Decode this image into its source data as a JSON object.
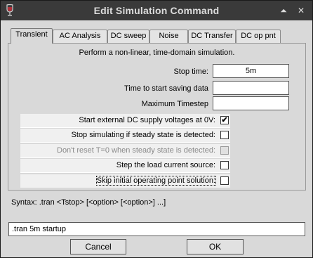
{
  "window": {
    "title": "Edit Simulation Command",
    "max_glyph": "⏶",
    "close_glyph": "✕"
  },
  "tabs": [
    {
      "label": "Transient",
      "active": true
    },
    {
      "label": "AC Analysis",
      "active": false
    },
    {
      "label": "DC sweep",
      "active": false
    },
    {
      "label": "Noise",
      "active": false
    },
    {
      "label": "DC Transfer",
      "active": false
    },
    {
      "label": "DC op pnt",
      "active": false
    }
  ],
  "transient": {
    "description": "Perform a non-linear, time-domain simulation.",
    "stop_time_label": "Stop time:",
    "stop_time_value": "5m",
    "start_saving_label": "Time to start saving data",
    "start_saving_value": "",
    "max_timestep_label": "Maximum Timestep",
    "max_timestep_value": "",
    "options": [
      {
        "label": "Start external DC supply voltages at 0V:",
        "checked": true,
        "enabled": true
      },
      {
        "label": "Stop simulating if steady state is detected:",
        "checked": false,
        "enabled": true
      },
      {
        "label": "Don't reset T=0 when steady state is detected:",
        "checked": false,
        "enabled": false
      },
      {
        "label": "Step the load current source:",
        "checked": false,
        "enabled": true
      },
      {
        "label": "Skip initial operating point solution:",
        "checked": false,
        "enabled": true
      }
    ]
  },
  "syntax": "Syntax:  .tran <Tstop> [<option> [<option>] ...]",
  "command_value": ".tran 5m startup",
  "buttons": {
    "cancel": "Cancel",
    "ok": "OK"
  },
  "colors": {
    "titlebar": "#3a3a3a",
    "dialog": "#d9d9d9",
    "checkbox_row": "#f0f0f0"
  }
}
